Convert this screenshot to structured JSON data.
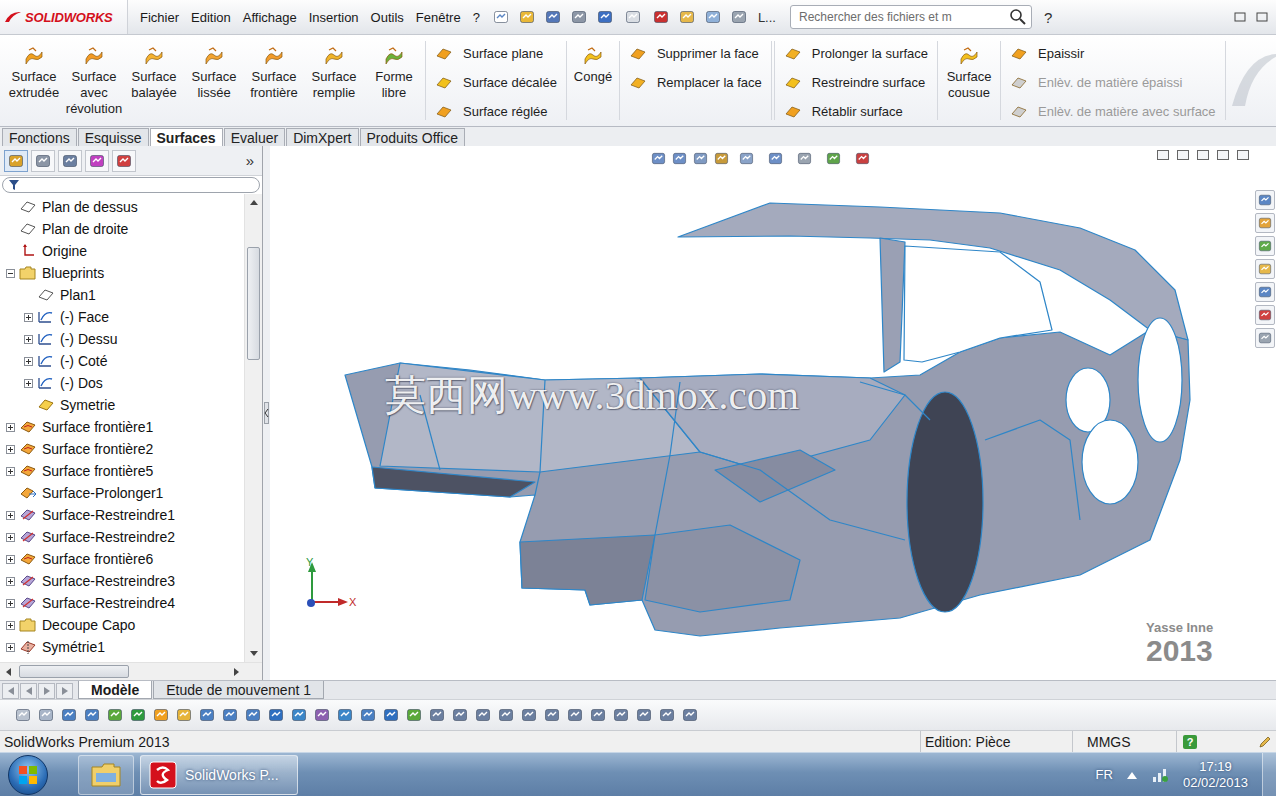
{
  "app": {
    "logo": "SOLIDWORKS",
    "toolbar_more": "L...",
    "search_placeholder": "Rechercher des fichiers et m",
    "help": "?"
  },
  "menu": [
    "Fichier",
    "Edition",
    "Affichage",
    "Insertion",
    "Outils",
    "Fenêtre",
    "?"
  ],
  "ribbon": [
    {
      "kind": "large",
      "label": "Surface extrudée",
      "disabled": false
    },
    {
      "kind": "large",
      "label": "Surface avec révolution",
      "disabled": false
    },
    {
      "kind": "large",
      "label": "Surface balayée",
      "disabled": false
    },
    {
      "kind": "large",
      "label": "Surface lissée",
      "disabled": false
    },
    {
      "kind": "large",
      "label": "Surface frontière",
      "disabled": false
    },
    {
      "kind": "large",
      "label": "Surface remplie",
      "disabled": false
    },
    {
      "kind": "large",
      "label": "Forme libre",
      "disabled": false
    },
    {
      "kind": "stack",
      "items": [
        {
          "label": "Surface plane",
          "disabled": false
        },
        {
          "label": "Surface décalée",
          "disabled": false
        },
        {
          "label": "Surface réglée",
          "disabled": false
        }
      ]
    },
    {
      "kind": "large",
      "label": "Congé",
      "disabled": false
    },
    {
      "kind": "stack",
      "items": [
        {
          "label": "Supprimer la face",
          "disabled": false
        },
        {
          "label": "Remplacer la face",
          "disabled": false
        }
      ]
    },
    {
      "kind": "stack",
      "items": [
        {
          "label": "Prolonger la surface",
          "disabled": false
        },
        {
          "label": "Restreindre surface",
          "disabled": false
        },
        {
          "label": "Rétablir surface",
          "disabled": false
        }
      ]
    },
    {
      "kind": "large",
      "label": "Surface cousue",
      "disabled": false
    },
    {
      "kind": "stack",
      "items": [
        {
          "label": "Epaissir",
          "disabled": false
        },
        {
          "label": "Enlèv. de matière épaissi",
          "disabled": true
        },
        {
          "label": "Enlèv. de matière avec surface",
          "disabled": true
        }
      ]
    }
  ],
  "tabs": [
    {
      "label": "Fonctions",
      "selected": false
    },
    {
      "label": "Esquisse",
      "selected": false
    },
    {
      "label": "Surfaces",
      "selected": true
    },
    {
      "label": "Evaluer",
      "selected": false
    },
    {
      "label": "DimXpert",
      "selected": false
    },
    {
      "label": "Produits Office",
      "selected": false
    }
  ],
  "feature_tree": {
    "more": "»",
    "items": [
      {
        "label": "Plan de dessus",
        "kind": "plane",
        "child": false,
        "expandable": false,
        "expanded": false
      },
      {
        "label": "Plan de droite",
        "kind": "plane",
        "child": false,
        "expandable": false,
        "expanded": false
      },
      {
        "label": "Origine",
        "kind": "origin",
        "child": false,
        "expandable": false,
        "expanded": false
      },
      {
        "label": "Blueprints",
        "kind": "folder",
        "child": false,
        "expandable": true,
        "expanded": true
      },
      {
        "label": "Plan1",
        "kind": "plane",
        "child": true,
        "expandable": false,
        "expanded": false
      },
      {
        "label": "(-) Face",
        "kind": "sketch",
        "child": true,
        "expandable": true,
        "expanded": false
      },
      {
        "label": "(-) Dessu",
        "kind": "sketch",
        "child": true,
        "expandable": true,
        "expanded": false
      },
      {
        "label": "(-) Coté",
        "kind": "sketch",
        "child": true,
        "expandable": true,
        "expanded": false
      },
      {
        "label": "(-) Dos",
        "kind": "sketch",
        "child": true,
        "expandable": true,
        "expanded": false
      },
      {
        "label": "Symetrie",
        "kind": "plane-accent",
        "child": true,
        "expandable": false,
        "expanded": false
      },
      {
        "label": "Surface frontière1",
        "kind": "boundary",
        "child": false,
        "expandable": true,
        "expanded": false
      },
      {
        "label": "Surface frontière2",
        "kind": "boundary",
        "child": false,
        "expandable": true,
        "expanded": false
      },
      {
        "label": "Surface frontière5",
        "kind": "boundary",
        "child": false,
        "expandable": true,
        "expanded": false
      },
      {
        "label": "Surface-Prolonger1",
        "kind": "extend",
        "child": false,
        "expandable": false,
        "expanded": false
      },
      {
        "label": "Surface-Restreindre1",
        "kind": "trim",
        "child": false,
        "expandable": true,
        "expanded": false
      },
      {
        "label": "Surface-Restreindre2",
        "kind": "trim",
        "child": false,
        "expandable": true,
        "expanded": false
      },
      {
        "label": "Surface frontière6",
        "kind": "boundary",
        "child": false,
        "expandable": true,
        "expanded": false
      },
      {
        "label": "Surface-Restreindre3",
        "kind": "trim",
        "child": false,
        "expandable": true,
        "expanded": false
      },
      {
        "label": "Surface-Restreindre4",
        "kind": "trim",
        "child": false,
        "expandable": true,
        "expanded": false
      },
      {
        "label": "Decoupe Capo",
        "kind": "folder",
        "child": false,
        "expandable": true,
        "expanded": false
      },
      {
        "label": "Symétrie1",
        "kind": "mirror",
        "child": false,
        "expandable": true,
        "expanded": false
      }
    ],
    "vertical_scroll": {
      "level": 0.083,
      "extent": 0.26
    },
    "horizontal_scroll": {
      "level": 0.01,
      "extent": 0.52
    }
  },
  "viewport": {
    "watermark": "莫西网www.3dmox.com",
    "signature": "Yasse Inne",
    "year": "2013",
    "axes": {
      "x": "X",
      "y": "Y"
    }
  },
  "bottom_tabs": [
    {
      "label": "Modèle",
      "selected": true
    },
    {
      "label": "Etude de mouvement 1",
      "selected": false
    }
  ],
  "status_bar": {
    "product": "SolidWorks Premium 2013",
    "mode": "Edition: Pièce",
    "units": "MMGS",
    "help": "?"
  },
  "taskbar": {
    "task": "SolidWorks P...",
    "language": "FR",
    "time": "17:19",
    "date": "02/02/2013"
  }
}
